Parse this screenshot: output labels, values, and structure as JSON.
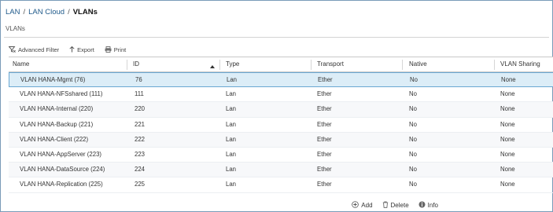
{
  "breadcrumb": {
    "items": [
      "LAN",
      "LAN Cloud"
    ],
    "separator": "/",
    "current": "VLANs"
  },
  "page": {
    "title": "VLANs"
  },
  "toolbar": {
    "advanced_filter": "Advanced Filter",
    "export": "Export",
    "print": "Print"
  },
  "table": {
    "columns": {
      "name": "Name",
      "id": "ID",
      "type": "Type",
      "transport": "Transport",
      "native": "Native",
      "sharing": "VLAN Sharing"
    },
    "sort": {
      "column": "ID",
      "direction": "ascending"
    },
    "selected_row": 0,
    "rows": [
      {
        "name": "VLAN HANA-Mgmt (76)",
        "id": "76",
        "type": "Lan",
        "transport": "Ether",
        "native": "No",
        "sharing": "None"
      },
      {
        "name": "VLAN HANA-NFSshared (111)",
        "id": "111",
        "type": "Lan",
        "transport": "Ether",
        "native": "No",
        "sharing": "None"
      },
      {
        "name": "VLAN HANA-Internal (220)",
        "id": "220",
        "type": "Lan",
        "transport": "Ether",
        "native": "No",
        "sharing": "None"
      },
      {
        "name": "VLAN HANA-Backup (221)",
        "id": "221",
        "type": "Lan",
        "transport": "Ether",
        "native": "No",
        "sharing": "None"
      },
      {
        "name": "VLAN HANA-Client (222)",
        "id": "222",
        "type": "Lan",
        "transport": "Ether",
        "native": "No",
        "sharing": "None"
      },
      {
        "name": "VLAN HANA-AppServer (223)",
        "id": "223",
        "type": "Lan",
        "transport": "Ether",
        "native": "No",
        "sharing": "None"
      },
      {
        "name": "VLAN HANA-DataSource (224)",
        "id": "224",
        "type": "Lan",
        "transport": "Ether",
        "native": "No",
        "sharing": "None"
      },
      {
        "name": "VLAN HANA-Replication (225)",
        "id": "225",
        "type": "Lan",
        "transport": "Ether",
        "native": "No",
        "sharing": "None"
      }
    ]
  },
  "footer": {
    "add": "Add",
    "delete": "Delete",
    "info": "Info"
  },
  "colors": {
    "breadcrumb_link": "#1f5a8a",
    "selected_row_bg": "#dcedf7",
    "selected_row_border": "#6aa8d2",
    "frame_border": "#7a9bb8"
  },
  "icons": [
    "filter-icon",
    "export-icon",
    "print-icon",
    "sort-up-icon",
    "add-icon",
    "delete-icon",
    "info-icon"
  ]
}
